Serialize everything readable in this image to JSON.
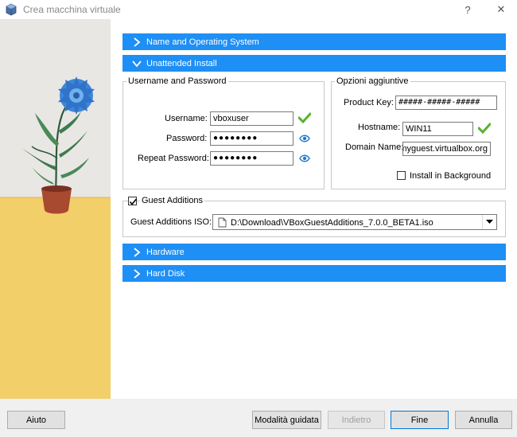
{
  "window": {
    "title": "Crea macchina virtuale",
    "help_glyph": "?",
    "close_glyph": "✕"
  },
  "sections": {
    "name_os": "Name and Operating System",
    "unattended": "Unattended Install",
    "hardware": "Hardware",
    "hard_disk": "Hard Disk"
  },
  "user_group": {
    "title": "Username and Password",
    "username_label": "Username:",
    "username_value": "vboxuser",
    "password_label": "Password:",
    "password_value": "●●●●●●●●",
    "repeat_label": "Repeat Password:",
    "repeat_value": "●●●●●●●●"
  },
  "options_group": {
    "title": "Opzioni aggiuntive",
    "product_key_label": "Product Key:",
    "product_key_value": "#####-#####-#####",
    "hostname_label": "Hostname:",
    "hostname_value": "WIN11",
    "domain_label": "Domain Name:",
    "domain_value": "myguest.virtualbox.org",
    "background_label": "Install in Background",
    "background_checked": false
  },
  "guest_additions": {
    "label": "Guest Additions",
    "checked": true,
    "iso_label": "Guest Additions ISO:",
    "iso_value": "D:\\Download\\VBoxGuestAdditions_7.0.0_BETA1.iso"
  },
  "buttons": {
    "help": "Aiuto",
    "guided": "Modalità guidata",
    "back": "Indietro",
    "finish": "Fine",
    "cancel": "Annulla"
  },
  "colors": {
    "accent": "#1e8ff5",
    "ok_green": "#57b32c"
  }
}
